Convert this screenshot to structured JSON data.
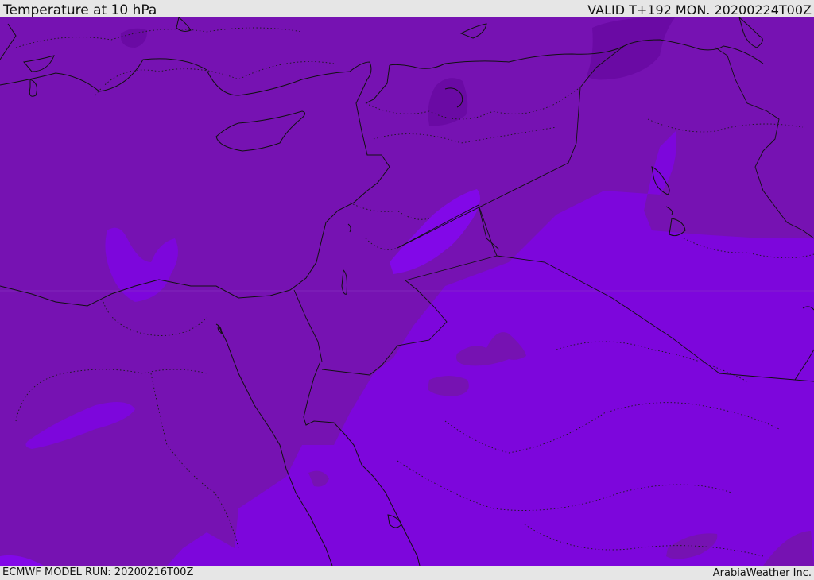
{
  "header": {
    "title": "Temperature at 10 hPa",
    "valid": "VALID T+192 MON. 20200224T00Z"
  },
  "footer": {
    "model_run": "ECMWF MODEL RUN: 20200216T00Z",
    "credit": "ArabiaWeather Inc."
  },
  "map": {
    "colors": {
      "warm_shade": "#7612b2",
      "cool_shade": "#7d06dc",
      "mid_shade": "#8208e8",
      "dark_patch": "#6a0aa4",
      "border": "#111111"
    }
  }
}
